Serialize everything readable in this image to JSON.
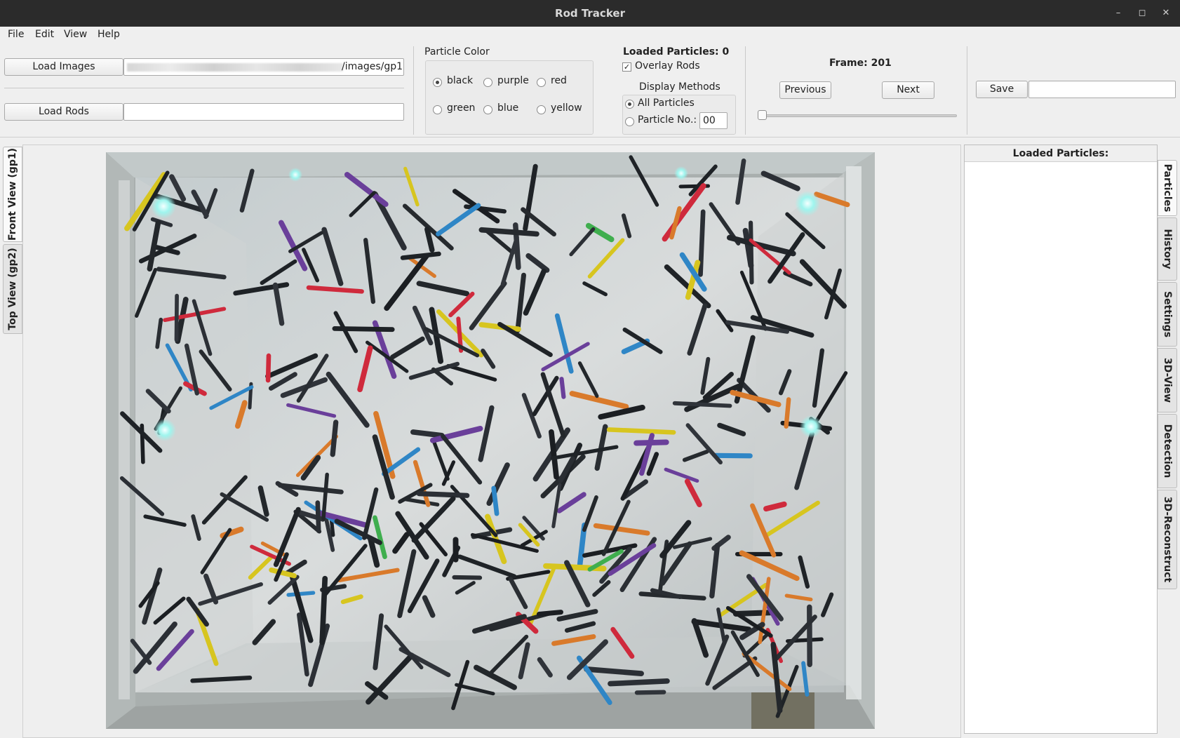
{
  "window": {
    "title": "Rod Tracker"
  },
  "menu": [
    "File",
    "Edit",
    "View",
    "Help"
  ],
  "toolbar": {
    "load_images_label": "Load Images",
    "images_path": "/images/gp1",
    "load_rods_label": "Load Rods",
    "rods_path": ""
  },
  "particle_color": {
    "title": "Particle Color",
    "options": [
      "black",
      "purple",
      "red",
      "green",
      "blue",
      "yellow"
    ],
    "selected": "black"
  },
  "status": {
    "loaded_particles": "Loaded Particles: 0",
    "overlay_rods_label": "Overlay Rods",
    "overlay_rods_checked": true,
    "display_methods_title": "Display Methods",
    "all_particles_label": "All Particles",
    "particle_no_label": "Particle No.:",
    "particle_no_value": "00"
  },
  "frame": {
    "label": "Frame: 201",
    "previous_label": "Previous",
    "next_label": "Next",
    "slider_position": 0.0
  },
  "save": {
    "label": "Save",
    "field_value": ""
  },
  "left_tabs": [
    {
      "label": "Front View (gp1)",
      "active": true
    },
    {
      "label": "Top View (gp2)",
      "active": false
    }
  ],
  "right_panel": {
    "header": "Loaded Particles:"
  },
  "right_tabs": [
    {
      "label": "Particles",
      "active": true
    },
    {
      "label": "History",
      "active": false
    },
    {
      "label": "Settings",
      "active": false
    },
    {
      "label": "3D-View",
      "active": false
    },
    {
      "label": "Detection",
      "active": false
    },
    {
      "label": "3D-Reconstruct",
      "active": false
    }
  ],
  "icons": {
    "minimize": "minimize-icon",
    "maximize": "maximize-icon",
    "close": "close-icon"
  }
}
